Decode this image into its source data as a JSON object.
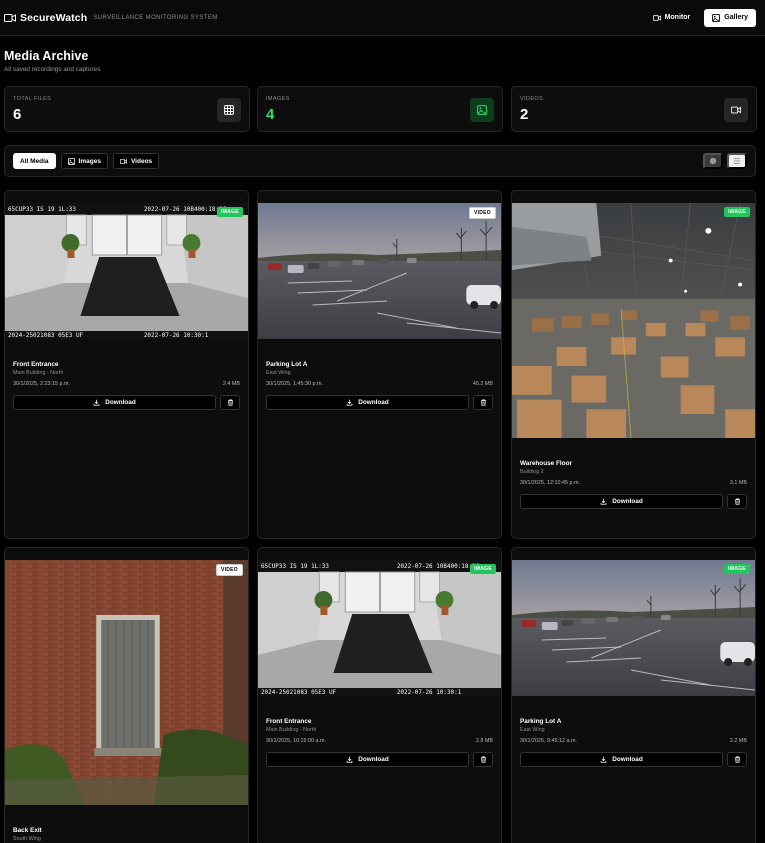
{
  "app": {
    "brand": "SecureWatch",
    "subtitle": "SURVEILLANCE MONITORING SYSTEM"
  },
  "nav": {
    "monitor_label": "Monitor",
    "gallery_label": "Gallery",
    "active": "Gallery"
  },
  "page": {
    "title": "Media Archive",
    "subtitle": "All saved recordings and captures"
  },
  "stats": [
    {
      "label": "TOTAL FILES",
      "value": "6",
      "icon": "grid-icon"
    },
    {
      "label": "IMAGES",
      "value": "4",
      "icon": "image-icon"
    },
    {
      "label": "VIDEOS",
      "value": "2",
      "icon": "video-icon"
    }
  ],
  "filters": {
    "all_label": "All Media",
    "images_label": "Images",
    "videos_label": "Videos",
    "active": "All Media",
    "view_mode": "grid"
  },
  "media": [
    {
      "type": "IMAGE",
      "title": "Front Entrance",
      "location": "Main Building - North",
      "date": "30/1/2025, 2:23:15 p.m.",
      "size": "2.4 MB",
      "scene": "lobby"
    },
    {
      "type": "VIDEO",
      "title": "Parking Lot A",
      "location": "East Wing",
      "date": "30/1/2025, 1:45:30 p.m.",
      "size": "45.2 MB",
      "scene": "parking"
    },
    {
      "type": "IMAGE",
      "title": "Warehouse Floor",
      "location": "Building 2",
      "date": "30/1/2025, 12:10:45 p.m.",
      "size": "3.1 MB",
      "scene": "warehouse"
    },
    {
      "type": "VIDEO",
      "title": "Back Exit",
      "location": "South Wing",
      "date": "",
      "size": "",
      "scene": "door"
    },
    {
      "type": "IMAGE",
      "title": "Front Entrance",
      "location": "Main Building - North",
      "date": "30/1/2025, 10:15:00 a.m.",
      "size": "2.8 MB",
      "scene": "lobby"
    },
    {
      "type": "IMAGE",
      "title": "Parking Lot A",
      "location": "East Wing",
      "date": "30/1/2025, 9:45:12 a.m.",
      "size": "2.2 MB",
      "scene": "parking"
    }
  ],
  "download_label": "Download",
  "overlays": {
    "lobby_top_left": "65CUP33 IS 19 1L:33",
    "lobby_top_right": "2022-07-26 10B400:18:36",
    "lobby_bottom_left": "2024-25021083  05E3  UF",
    "lobby_bottom_right": "2022-07-26 10:30:1"
  },
  "colors": {
    "accent_green": "#22c55e",
    "stat_green": "#2fdc6e",
    "background": "#000000",
    "card": "#0d0d0d",
    "border": "#262626"
  }
}
